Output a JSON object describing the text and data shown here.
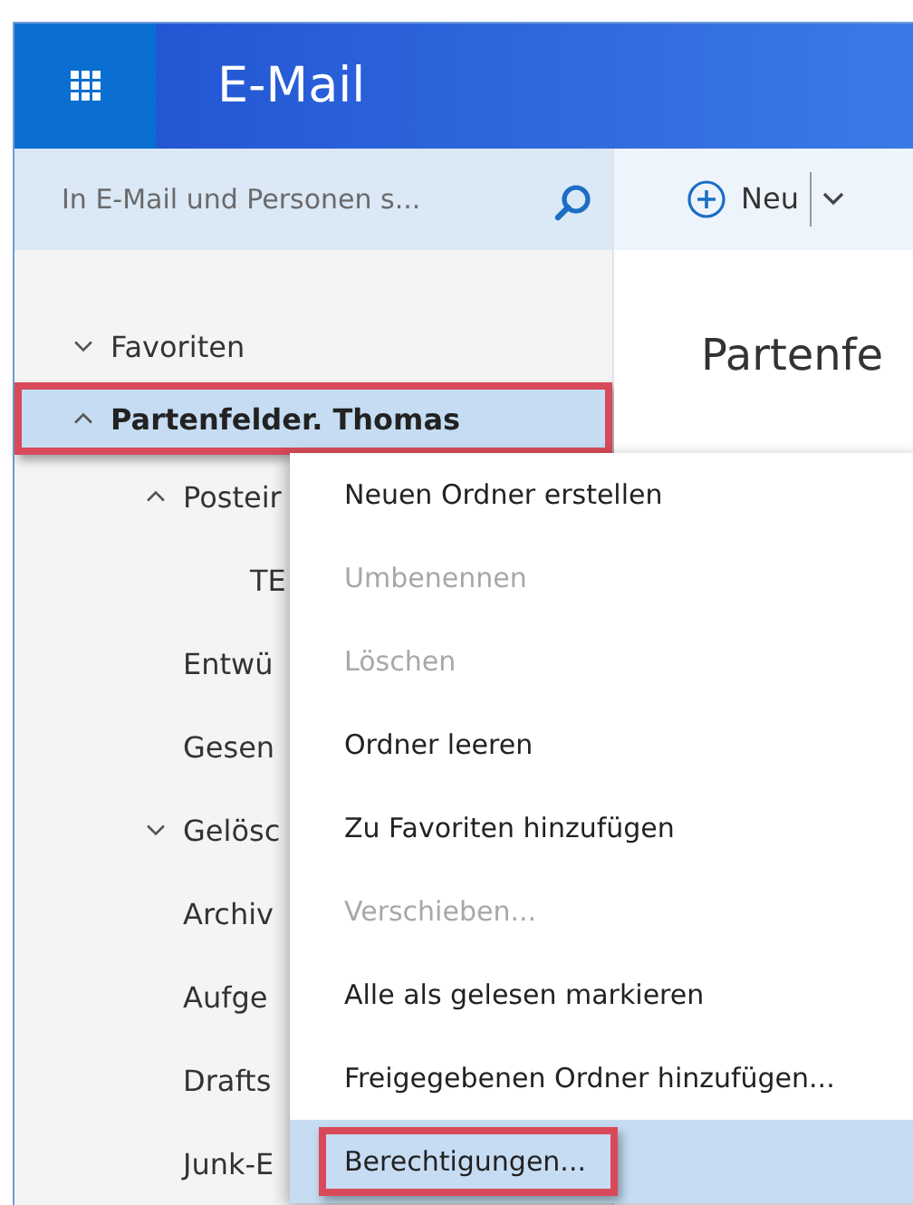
{
  "header": {
    "title": "E-Mail"
  },
  "search": {
    "placeholder": "In E-Mail und Personen s..."
  },
  "toolbar": {
    "new_button": "Neu"
  },
  "folders": [
    {
      "label": "Favoriten",
      "expanded": false,
      "selected": false,
      "annotated": false
    },
    {
      "label": "Partenfelder. Thomas",
      "expanded": true,
      "selected": true,
      "annotated": true,
      "children": [
        {
          "label": "Posteir",
          "expanded": true,
          "selected": false,
          "annotated": false,
          "children": [
            {
              "label": "TE",
              "selected": false,
              "annotated": false
            }
          ]
        },
        {
          "label": "Entwü",
          "selected": false,
          "annotated": false
        },
        {
          "label": "Gesen",
          "selected": false,
          "annotated": false
        },
        {
          "label": "Gelösc",
          "expanded": false,
          "selected": false,
          "annotated": false
        },
        {
          "label": "Archiv",
          "selected": false,
          "annotated": false
        },
        {
          "label": "Aufge",
          "selected": false,
          "annotated": false
        },
        {
          "label": "Drafts",
          "selected": false,
          "annotated": false
        },
        {
          "label": "Junk-E",
          "selected": false,
          "annotated": false
        }
      ]
    }
  ],
  "reading_pane": {
    "heading": "Partenfe"
  },
  "context_menu": [
    {
      "label": "Neuen Ordner erstellen",
      "disabled": false,
      "selected": false,
      "annotated": false
    },
    {
      "label": "Umbenennen",
      "disabled": true,
      "selected": false,
      "annotated": false
    },
    {
      "label": "Löschen",
      "disabled": true,
      "selected": false,
      "annotated": false
    },
    {
      "label": "Ordner leeren",
      "disabled": false,
      "selected": false,
      "annotated": false
    },
    {
      "label": "Zu Favoriten hinzufügen",
      "disabled": false,
      "selected": false,
      "annotated": false
    },
    {
      "label": "Verschieben...",
      "disabled": true,
      "selected": false,
      "annotated": false
    },
    {
      "label": "Alle als gelesen markieren",
      "disabled": false,
      "selected": false,
      "annotated": false
    },
    {
      "label": "Freigegebenen Ordner hinzufügen...",
      "disabled": false,
      "selected": false,
      "annotated": false
    },
    {
      "label": "Berechtigungen...",
      "disabled": false,
      "selected": true,
      "annotated": true
    }
  ]
}
